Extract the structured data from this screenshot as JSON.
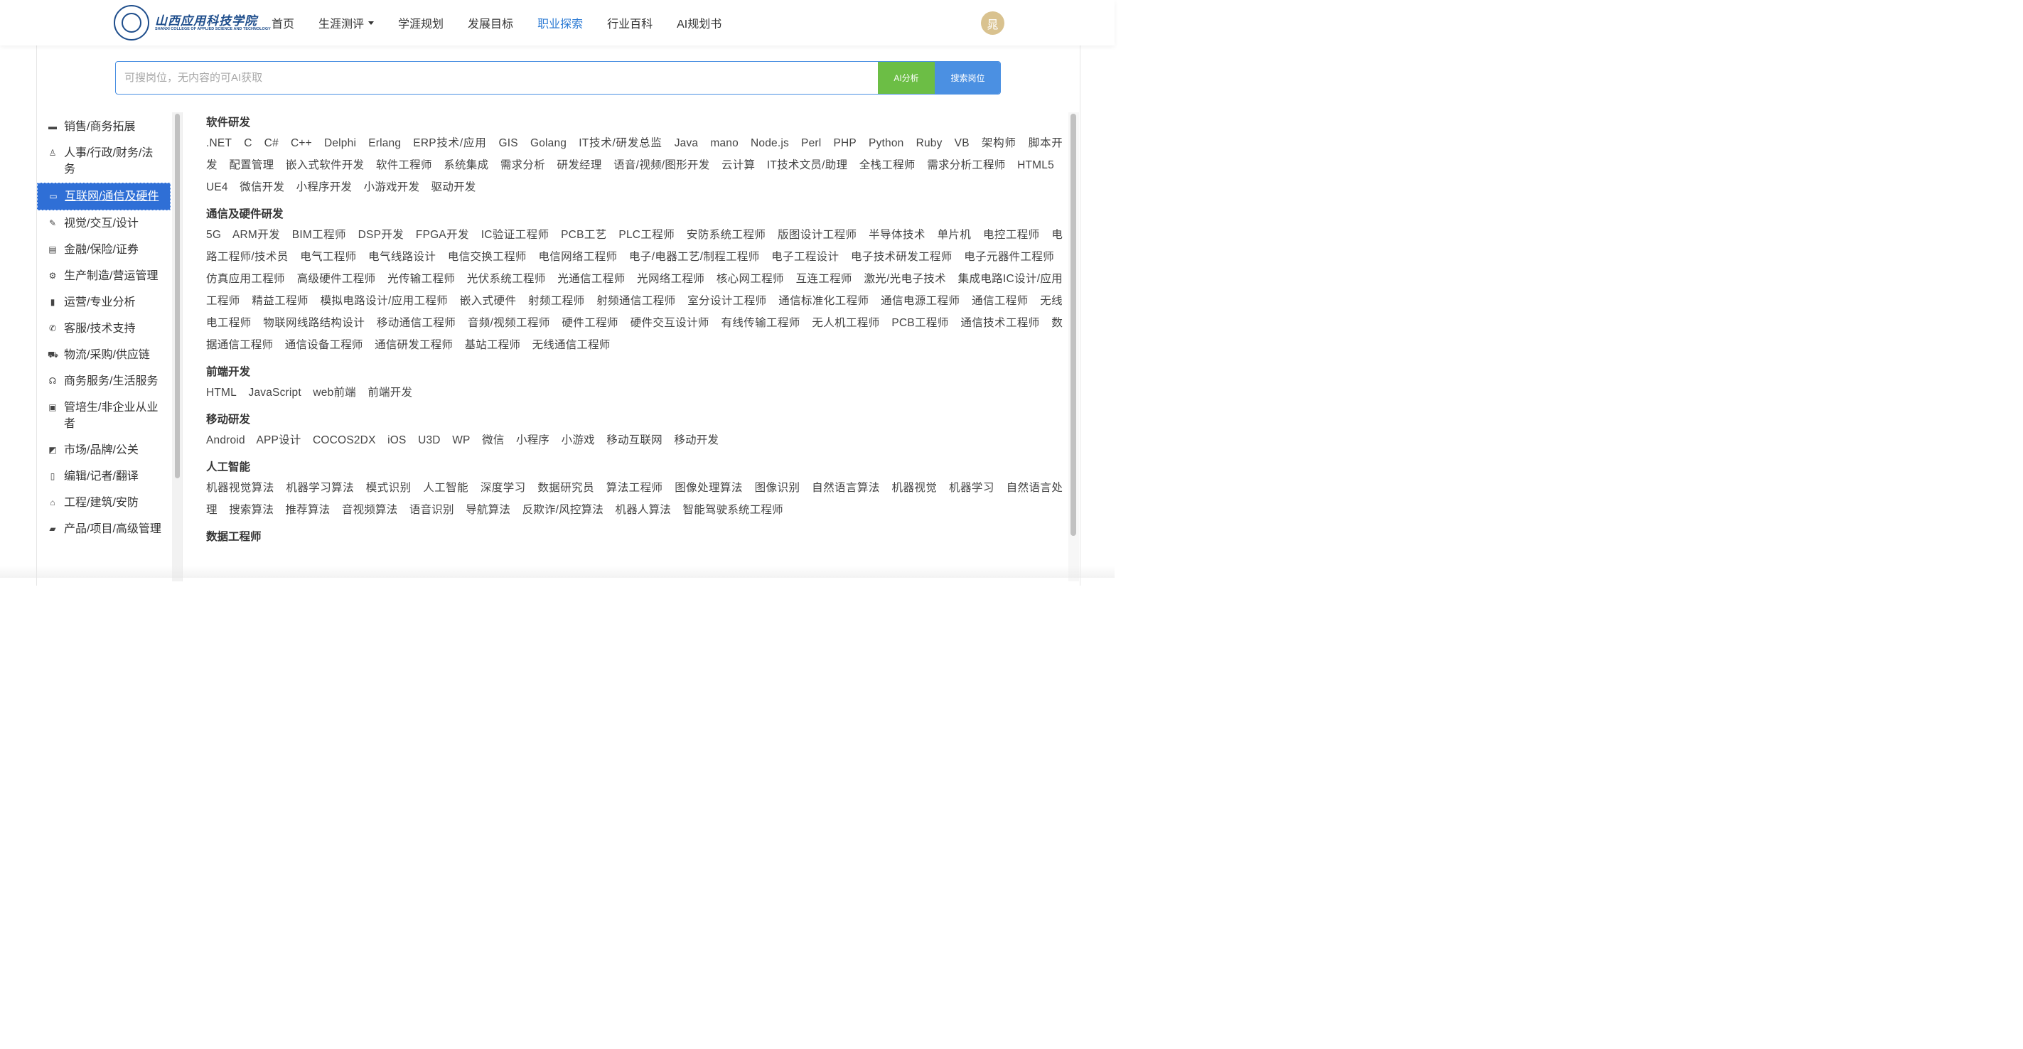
{
  "header": {
    "logo_cn": "山西应用科技学院",
    "logo_en": "SHANXI COLLEGE OF APPLIED SCIENCE AND TECHNOLOGY",
    "nav": [
      {
        "label": "首页"
      },
      {
        "label": "生涯测评"
      },
      {
        "label": "学涯规划"
      },
      {
        "label": "发展目标"
      },
      {
        "label": "职业探索"
      },
      {
        "label": "行业百科"
      },
      {
        "label": "AI规划书"
      }
    ],
    "active_nav": "职业探索",
    "avatar": "晁"
  },
  "search": {
    "placeholder": "可搜岗位，无内容的可AI获取",
    "ai_button": "AI分析",
    "search_button": "搜索岗位"
  },
  "sidebar": {
    "items": [
      {
        "label": "销售/商务拓展",
        "icon": "briefcase-icon"
      },
      {
        "label": "人事/行政/财务/法务",
        "icon": "user-icon"
      },
      {
        "label": "互联网/通信及硬件",
        "icon": "monitor-icon"
      },
      {
        "label": "视觉/交互/设计",
        "icon": "pen-icon"
      },
      {
        "label": "金融/保险/证券",
        "icon": "card-icon"
      },
      {
        "label": "生产制造/营运管理",
        "icon": "gear-icon"
      },
      {
        "label": "运营/专业分析",
        "icon": "bar-chart-icon"
      },
      {
        "label": "客服/技术支持",
        "icon": "phone-icon"
      },
      {
        "label": "物流/采购/供应链",
        "icon": "truck-icon"
      },
      {
        "label": "商务服务/生活服务",
        "icon": "headset-icon"
      },
      {
        "label": "管培生/非企业从业者",
        "icon": "clipboard-icon"
      },
      {
        "label": "市场/品牌/公关",
        "icon": "trend-icon"
      },
      {
        "label": "编辑/记者/翻译",
        "icon": "book-icon"
      },
      {
        "label": "工程/建筑/安防",
        "icon": "house-icon"
      },
      {
        "label": "产品/项目/高级管理",
        "icon": "bag-icon"
      }
    ],
    "active": "互联网/通信及硬件"
  },
  "categories": [
    {
      "title": "软件研发",
      "tags": [
        ".NET",
        "C",
        "C#",
        "C++",
        "Delphi",
        "Erlang",
        "ERP技术/应用",
        "GIS",
        "Golang",
        "IT技术/研发总监",
        "Java",
        "mano",
        "Node.js",
        "Perl",
        "PHP",
        "Python",
        "Ruby",
        "VB",
        "架构师",
        "脚本开发",
        "配置管理",
        "嵌入式软件开发",
        "软件工程师",
        "系统集成",
        "需求分析",
        "研发经理",
        "语音/视频/图形开发",
        "云计算",
        "IT技术文员/助理",
        "全栈工程师",
        "需求分析工程师",
        "HTML5",
        "UE4",
        "微信开发",
        "小程序开发",
        "小游戏开发",
        "驱动开发"
      ]
    },
    {
      "title": "通信及硬件研发",
      "tags": [
        "5G",
        "ARM开发",
        "BIM工程师",
        "DSP开发",
        "FPGA开发",
        "IC验证工程师",
        "PCB工艺",
        "PLC工程师",
        "安防系统工程师",
        "版图设计工程师",
        "半导体技术",
        "单片机",
        "电控工程师",
        "电路工程师/技术员",
        "电气工程师",
        "电气线路设计",
        "电信交换工程师",
        "电信网络工程师",
        "电子/电器工艺/制程工程师",
        "电子工程设计",
        "电子技术研发工程师",
        "电子元器件工程师",
        "仿真应用工程师",
        "高级硬件工程师",
        "光传输工程师",
        "光伏系统工程师",
        "光通信工程师",
        "光网络工程师",
        "核心网工程师",
        "互连工程师",
        "激光/光电子技术",
        "集成电路IC设计/应用工程师",
        "精益工程师",
        "模拟电路设计/应用工程师",
        "嵌入式硬件",
        "射频工程师",
        "射频通信工程师",
        "室分设计工程师",
        "通信标准化工程师",
        "通信电源工程师",
        "通信工程师",
        "无线电工程师",
        "物联网线路结构设计",
        "移动通信工程师",
        "音频/视频工程师",
        "硬件工程师",
        "硬件交互设计师",
        "有线传输工程师",
        "无人机工程师",
        "PCB工程师",
        "通信技术工程师",
        "数据通信工程师",
        "通信设备工程师",
        "通信研发工程师",
        "基站工程师",
        "无线通信工程师"
      ]
    },
    {
      "title": "前端开发",
      "tags": [
        "HTML",
        "JavaScript",
        "web前端",
        "前端开发"
      ]
    },
    {
      "title": "移动研发",
      "tags": [
        "Android",
        "APP设计",
        "COCOS2DX",
        "iOS",
        "U3D",
        "WP",
        "微信",
        "小程序",
        "小游戏",
        "移动互联网",
        "移动开发"
      ]
    },
    {
      "title": "人工智能",
      "tags": [
        "机器视觉算法",
        "机器学习算法",
        "模式识别",
        "人工智能",
        "深度学习",
        "数据研究员",
        "算法工程师",
        "图像处理算法",
        "图像识别",
        "自然语言算法",
        "机器视觉",
        "机器学习",
        "自然语言处理",
        "搜索算法",
        "推荐算法",
        "音视频算法",
        "语音识别",
        "导航算法",
        "反欺诈/风控算法",
        "机器人算法",
        "智能驾驶系统工程师"
      ]
    },
    {
      "title": "数据工程师",
      "tags": []
    }
  ]
}
